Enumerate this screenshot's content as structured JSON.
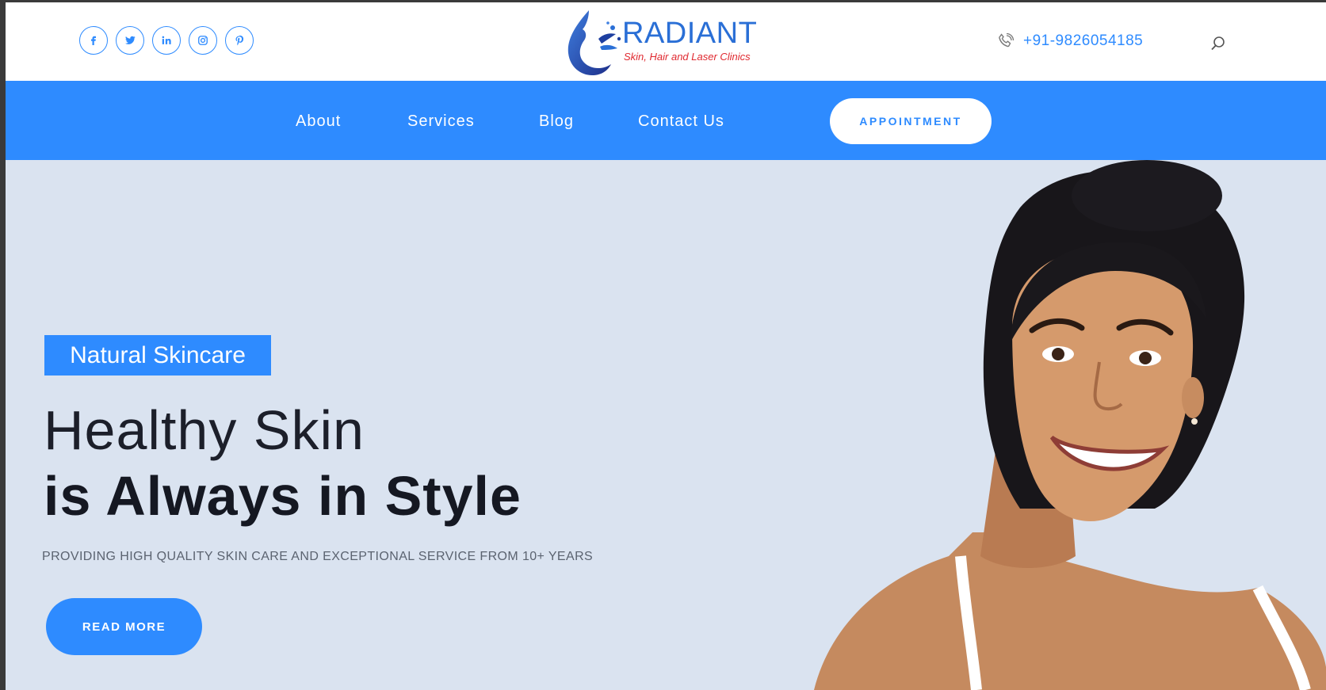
{
  "header": {
    "socials": [
      {
        "icon": "facebook-icon",
        "glyph": "f"
      },
      {
        "icon": "twitter-icon",
        "glyph": "t"
      },
      {
        "icon": "linkedin-icon",
        "glyph": "in"
      },
      {
        "icon": "instagram-icon",
        "glyph": "ig"
      },
      {
        "icon": "pinterest-icon",
        "glyph": "p"
      }
    ],
    "logo": {
      "name": "RADIANT",
      "tagline": "Skin, Hair and Laser Clinics"
    },
    "phone": "+91-9826054185"
  },
  "nav": {
    "items": [
      {
        "label": "About"
      },
      {
        "label": "Services"
      },
      {
        "label": "Blog"
      },
      {
        "label": "Contact Us"
      }
    ],
    "appointment_label": "APPOINTMENT"
  },
  "hero": {
    "badge": "Natural Skincare",
    "headline_line1": "Healthy Skin",
    "headline_line2": "is Always in Style",
    "subtitle": "PROVIDING HIGH QUALITY SKIN CARE AND EXCEPTIONAL SERVICE FROM 10+ YEARS",
    "cta_label": "READ MORE"
  },
  "colors": {
    "accent": "#2e8bff",
    "hero_bg": "#dae3f0",
    "logo_blue": "#2a6fd6",
    "logo_red": "#e0282f",
    "heading": "#151822"
  }
}
